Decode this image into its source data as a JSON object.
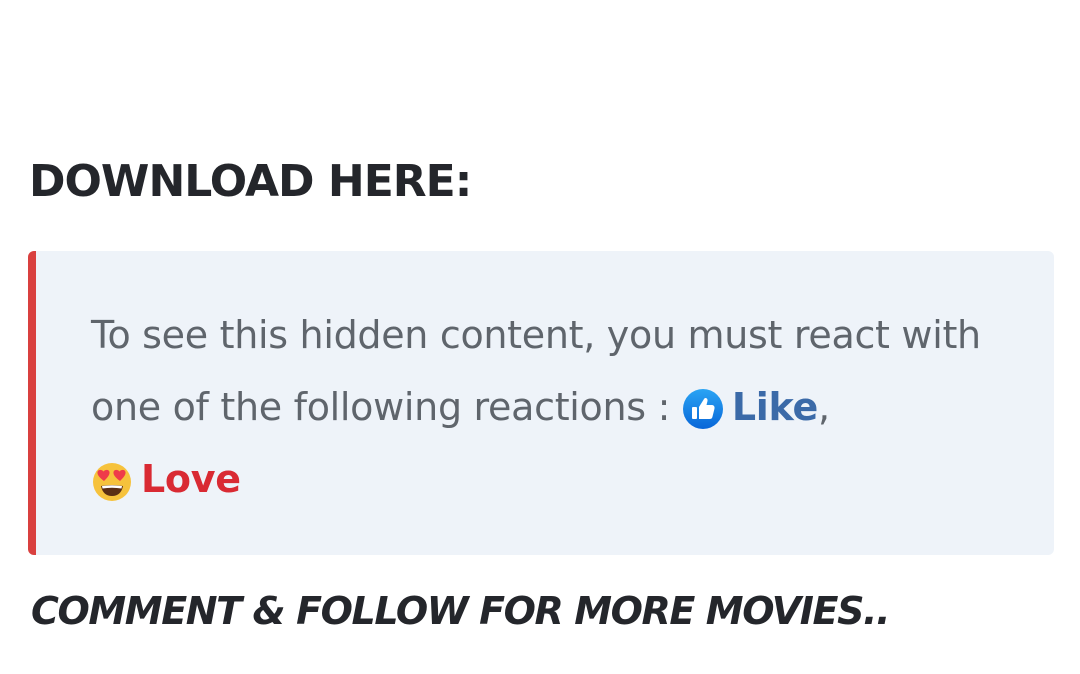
{
  "heading": "DOWNLOAD HERE:",
  "notice": {
    "text": "To see this hidden content, you must react with one of the following reactions :",
    "separator": ",",
    "reactions": [
      {
        "label": "Like",
        "icon": "thumbs-up-icon",
        "color": "#3b6aa8"
      },
      {
        "label": "Love",
        "icon": "heart-eyes-icon",
        "color": "#d92a33"
      }
    ],
    "accent_color": "#d9403f",
    "background_color": "#eef3f9"
  },
  "footer_note": "COMMENT & FOLLOW FOR MORE MOVIES.."
}
